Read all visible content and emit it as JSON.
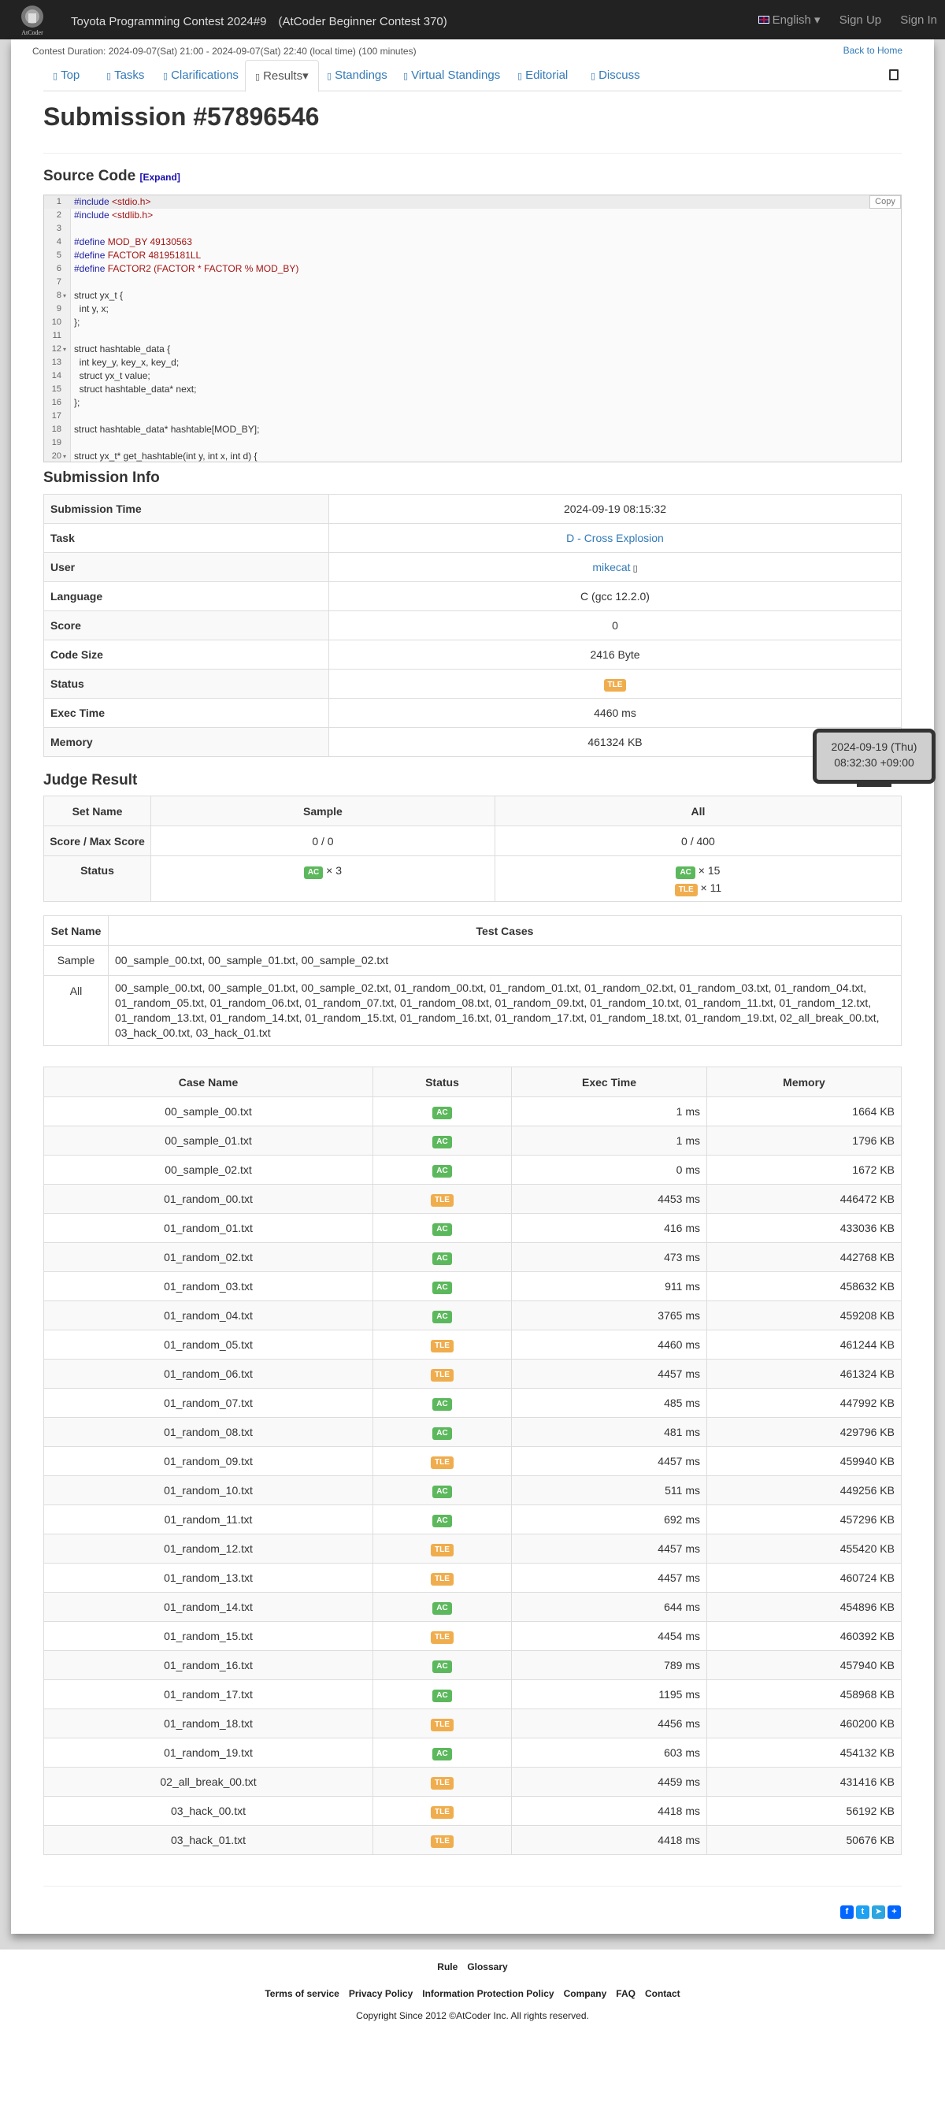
{
  "navbar": {
    "title": "Toyota Programming Contest 2024#9　(AtCoder Beginner Contest 370)",
    "language": "English",
    "sign_up": "Sign Up",
    "sign_in": "Sign In",
    "logo_text": "AtCoder"
  },
  "contest_duration": "Contest Duration: 2024-09-07(Sat) 21:00 - 2024-09-07(Sat) 22:40 (local time) (100 minutes)",
  "back_home": "Back to Home",
  "tabs": [
    "Top",
    "Tasks",
    "Clarifications",
    "Results",
    "Standings",
    "Virtual Standings",
    "Editorial",
    "Discuss"
  ],
  "page_title": "Submission #57896546",
  "source_code": {
    "heading": "Source Code",
    "expand": "[Expand]",
    "copy": "Copy",
    "lines": [
      "#include <stdio.h>",
      "#include <stdlib.h>",
      "",
      "#define MOD_BY 49130563",
      "#define FACTOR 48195181LL",
      "#define FACTOR2 (FACTOR * FACTOR % MOD_BY)",
      "",
      "struct yx_t {",
      "  int y, x;",
      "};",
      "",
      "struct hashtable_data {",
      "  int key_y, key_x, key_d;",
      "  struct yx_t value;",
      "  struct hashtable_data* next;",
      "};",
      "",
      "struct hashtable_data* hashtable[MOD_BY];",
      "",
      "struct yx_t* get_hashtable(int y, int x, int d) {"
    ]
  },
  "submission_info": {
    "heading": "Submission Info",
    "rows": [
      {
        "label": "Submission Time",
        "value": "2024-09-19 08:15:32"
      },
      {
        "label": "Task",
        "value": "D - Cross Explosion"
      },
      {
        "label": "User",
        "value": "mikecat"
      },
      {
        "label": "Language",
        "value": "C (gcc 12.2.0)"
      },
      {
        "label": "Score",
        "value": "0"
      },
      {
        "label": "Code Size",
        "value": "2416 Byte"
      },
      {
        "label": "Status",
        "value": "TLE"
      },
      {
        "label": "Exec Time",
        "value": "4460 ms"
      },
      {
        "label": "Memory",
        "value": "461324 KB"
      }
    ]
  },
  "tooltip": {
    "line1": "2024-09-19 (Thu)",
    "line2": "08:32:30 +09:00"
  },
  "judge_result": {
    "heading": "Judge Result",
    "header": [
      "Set Name",
      "Sample",
      "All"
    ],
    "score_label": "Score / Max Score",
    "score_sample": "0 / 0",
    "score_all": "0 / 400",
    "status_label": "Status",
    "sample_ac": "× 3",
    "all_ac": "× 15",
    "all_tle": "× 11",
    "ac": "AC",
    "tle": "TLE"
  },
  "test_cases": {
    "header": [
      "Set Name",
      "Test Cases"
    ],
    "sample_label": "Sample",
    "sample": "00_sample_00.txt, 00_sample_01.txt, 00_sample_02.txt",
    "all_label": "All",
    "all": "00_sample_00.txt, 00_sample_01.txt, 00_sample_02.txt, 01_random_00.txt, 01_random_01.txt, 01_random_02.txt, 01_random_03.txt, 01_random_04.txt, 01_random_05.txt, 01_random_06.txt, 01_random_07.txt, 01_random_08.txt, 01_random_09.txt, 01_random_10.txt, 01_random_11.txt, 01_random_12.txt, 01_random_13.txt, 01_random_14.txt, 01_random_15.txt, 01_random_16.txt, 01_random_17.txt, 01_random_18.txt, 01_random_19.txt, 02_all_break_00.txt, 03_hack_00.txt, 03_hack_01.txt"
  },
  "case_details": {
    "header": [
      "Case Name",
      "Status",
      "Exec Time",
      "Memory"
    ],
    "rows": [
      [
        "00_sample_00.txt",
        "AC",
        "1 ms",
        "1664 KB"
      ],
      [
        "00_sample_01.txt",
        "AC",
        "1 ms",
        "1796 KB"
      ],
      [
        "00_sample_02.txt",
        "AC",
        "0 ms",
        "1672 KB"
      ],
      [
        "01_random_00.txt",
        "TLE",
        "4453 ms",
        "446472 KB"
      ],
      [
        "01_random_01.txt",
        "AC",
        "416 ms",
        "433036 KB"
      ],
      [
        "01_random_02.txt",
        "AC",
        "473 ms",
        "442768 KB"
      ],
      [
        "01_random_03.txt",
        "AC",
        "911 ms",
        "458632 KB"
      ],
      [
        "01_random_04.txt",
        "AC",
        "3765 ms",
        "459208 KB"
      ],
      [
        "01_random_05.txt",
        "TLE",
        "4460 ms",
        "461244 KB"
      ],
      [
        "01_random_06.txt",
        "TLE",
        "4457 ms",
        "461324 KB"
      ],
      [
        "01_random_07.txt",
        "AC",
        "485 ms",
        "447992 KB"
      ],
      [
        "01_random_08.txt",
        "AC",
        "481 ms",
        "429796 KB"
      ],
      [
        "01_random_09.txt",
        "TLE",
        "4457 ms",
        "459940 KB"
      ],
      [
        "01_random_10.txt",
        "AC",
        "511 ms",
        "449256 KB"
      ],
      [
        "01_random_11.txt",
        "AC",
        "692 ms",
        "457296 KB"
      ],
      [
        "01_random_12.txt",
        "TLE",
        "4457 ms",
        "455420 KB"
      ],
      [
        "01_random_13.txt",
        "TLE",
        "4457 ms",
        "460724 KB"
      ],
      [
        "01_random_14.txt",
        "AC",
        "644 ms",
        "454896 KB"
      ],
      [
        "01_random_15.txt",
        "TLE",
        "4454 ms",
        "460392 KB"
      ],
      [
        "01_random_16.txt",
        "AC",
        "789 ms",
        "457940 KB"
      ],
      [
        "01_random_17.txt",
        "AC",
        "1195 ms",
        "458968 KB"
      ],
      [
        "01_random_18.txt",
        "TLE",
        "4456 ms",
        "460200 KB"
      ],
      [
        "01_random_19.txt",
        "AC",
        "603 ms",
        "454132 KB"
      ],
      [
        "02_all_break_00.txt",
        "TLE",
        "4459 ms",
        "431416 KB"
      ],
      [
        "03_hack_00.txt",
        "TLE",
        "4418 ms",
        "56192 KB"
      ],
      [
        "03_hack_01.txt",
        "TLE",
        "4418 ms",
        "50676 KB"
      ]
    ]
  },
  "footer": {
    "row1": [
      "Rule",
      "Glossary"
    ],
    "row2": [
      "Terms of service",
      "Privacy Policy",
      "Information Protection Policy",
      "Company",
      "FAQ",
      "Contact"
    ],
    "copyright": "Copyright Since 2012 ©AtCoder Inc. All rights reserved."
  },
  "colors": {
    "ac": "#5cb85c",
    "tle": "#f0ad4e",
    "link": "#337ab7",
    "navbar": "#222222"
  }
}
